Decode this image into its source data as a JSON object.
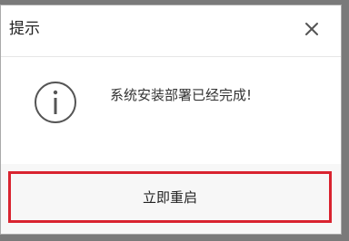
{
  "dialog": {
    "title": "提示",
    "close_icon": "close-icon",
    "message": "系统安装部署已经完成!",
    "message_icon": "info-icon",
    "restart_button_label": "立即重启"
  },
  "colors": {
    "highlight_border": "#d9232f",
    "background_overlay": "#7a7a7a"
  }
}
